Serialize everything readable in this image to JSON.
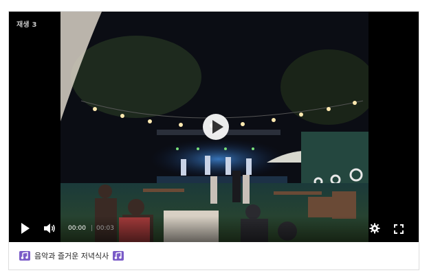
{
  "player": {
    "badge": "재생 3",
    "current_time": "00:00",
    "separator": "|",
    "duration": "00:03",
    "icons": {
      "big_play": "play-icon",
      "play": "play-icon",
      "volume": "volume-icon",
      "settings": "gear-icon",
      "fullscreen": "fullscreen-icon"
    }
  },
  "caption": {
    "text": "음악과 즐거운 저녁식사",
    "leading_icon": "music-notes-icon",
    "trailing_icon": "music-notes-icon"
  }
}
